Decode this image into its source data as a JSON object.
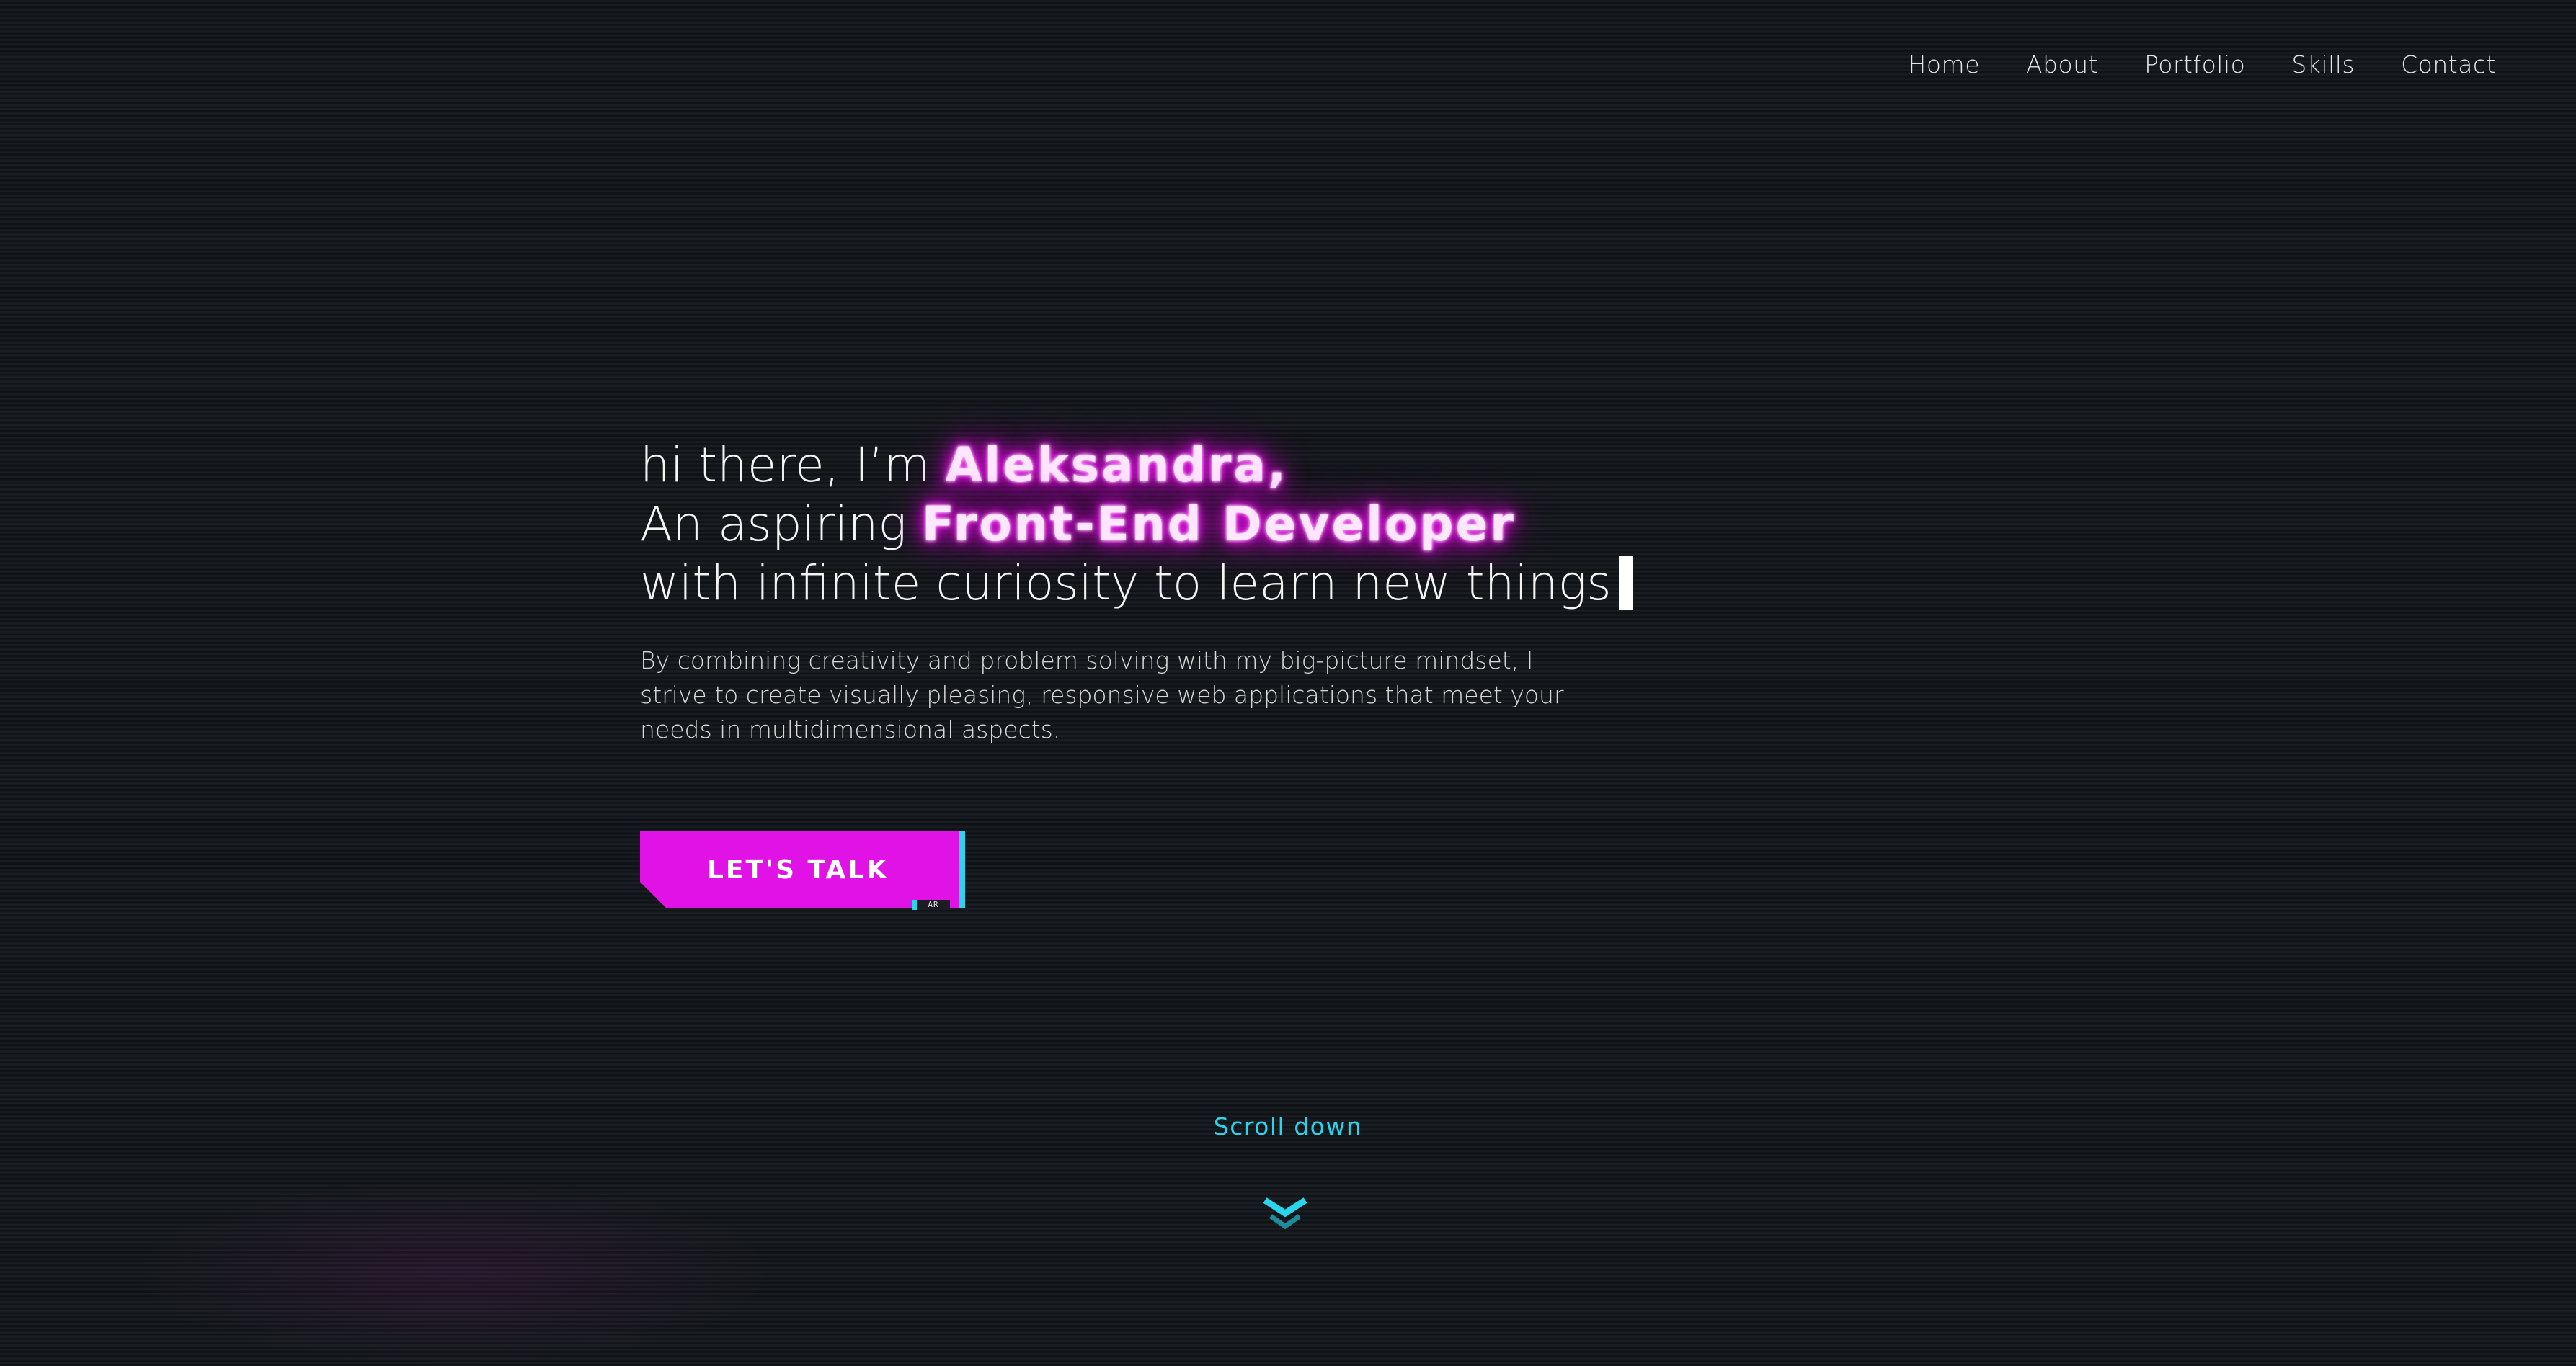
{
  "nav": {
    "items": [
      {
        "label": "Home"
      },
      {
        "label": "About"
      },
      {
        "label": "Portfolio"
      },
      {
        "label": "Skills"
      },
      {
        "label": "Contact"
      }
    ]
  },
  "hero": {
    "line1_prefix": "hi there, I’m ",
    "line1_highlight": "Aleksandra,",
    "line2_prefix": "An aspiring ",
    "line2_highlight": "Front-End Developer",
    "line3": "with infinite curiosity to learn new things",
    "description": "By combining creativity and problem solving with my big-picture mindset, I strive to create visually pleasing, responsive web applications that meet your needs in multidimensional aspects."
  },
  "cta": {
    "label": "LET'S TALK",
    "tag": "AR"
  },
  "scroll": {
    "label": "Scroll down",
    "icon": "double-chevron-down-icon"
  },
  "colors": {
    "background": "#15181c",
    "accent_magenta": "#e012e6",
    "accent_cyan": "#2ad4ea",
    "text": "#f2f2f2"
  }
}
